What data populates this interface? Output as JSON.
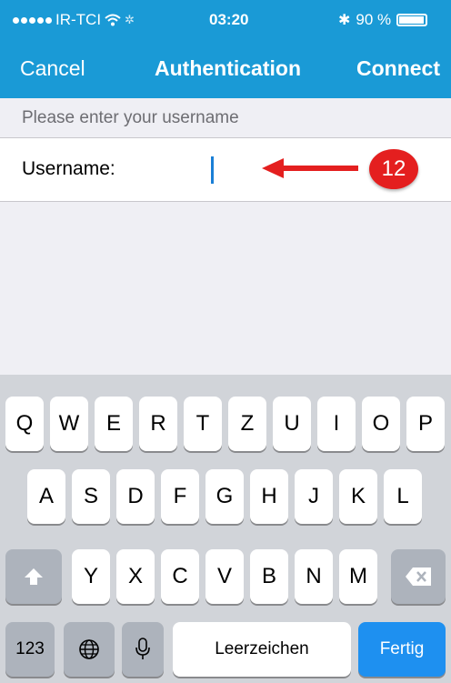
{
  "status_bar": {
    "carrier": "IR-TCI",
    "time": "03:20",
    "battery": "90 %",
    "icons": [
      "signal-dots-icon",
      "wifi-icon",
      "activity-icon",
      "bluetooth-icon",
      "battery-icon"
    ]
  },
  "nav": {
    "cancel_label": "Cancel",
    "title": "Authentication",
    "connect_label": "Connect"
  },
  "form": {
    "prompt": "Please enter your username",
    "username_label": "Username:",
    "username_value": ""
  },
  "annotation": {
    "badge": "12",
    "color": "#e41f1f"
  },
  "keyboard": {
    "row1": [
      "Q",
      "W",
      "E",
      "R",
      "T",
      "Z",
      "U",
      "I",
      "O",
      "P"
    ],
    "row2": [
      "A",
      "S",
      "D",
      "F",
      "G",
      "H",
      "J",
      "K",
      "L"
    ],
    "row3": [
      "Y",
      "X",
      "C",
      "V",
      "B",
      "N",
      "M"
    ],
    "numbers_label": "123",
    "space_label": "Leerzeichen",
    "return_label": "Fertig"
  },
  "colors": {
    "header": "#1a9ad6",
    "accent": "#1e90f0"
  }
}
